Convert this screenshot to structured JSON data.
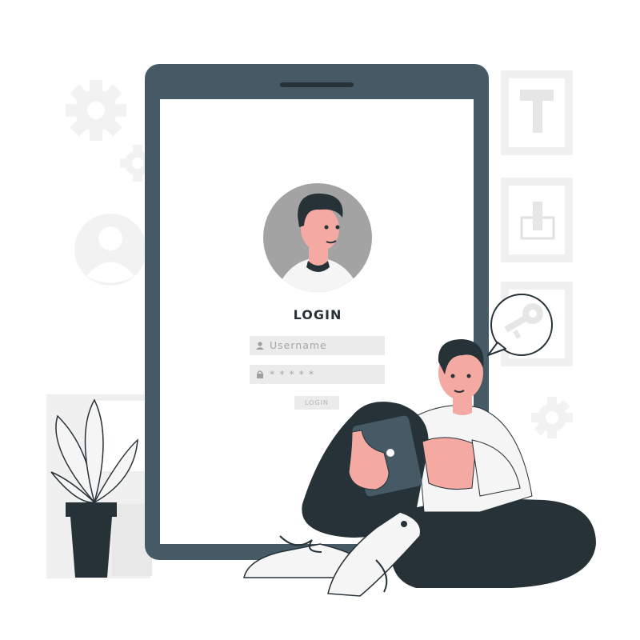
{
  "login": {
    "title": "LOGIN",
    "username_placeholder": "Username",
    "password_placeholder": "* * * * *",
    "button_label": "LOGIN"
  },
  "icons": [
    "gear-icon",
    "user-avatar-icon",
    "key-icon",
    "user-icon",
    "lock-icon"
  ],
  "colors": {
    "device_frame": "#455a64",
    "dark": "#263238",
    "skin": "#f5a9a3",
    "light_gray": "#ebebeb"
  }
}
